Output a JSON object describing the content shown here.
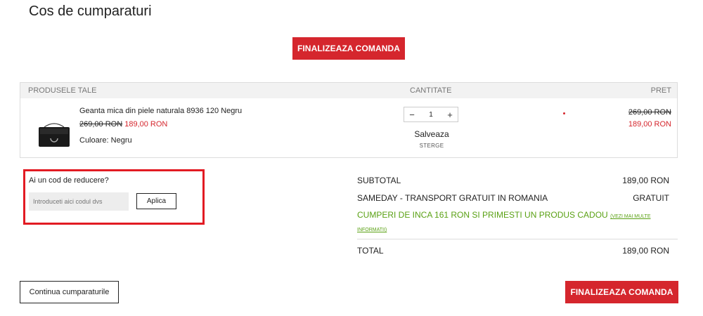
{
  "title": "Cos de cumparaturi",
  "checkout_label": "FINALIZEAZA COMANDA",
  "cart": {
    "headers": {
      "products": "PRODUSELE TALE",
      "quantity": "CANTITATE",
      "price": "PRET"
    },
    "item": {
      "name": "Geanta mica din piele naturala 8936 120 Negru",
      "old_price": "269,00 RON",
      "new_price": "189,00 RON",
      "attribute": "Culoare: Negru",
      "quantity": "1",
      "save_label": "Salveaza",
      "remove_label": "STERGE",
      "thumbnail_icon": "black-handbag-image"
    }
  },
  "coupon": {
    "question": "Ai un cod de reducere?",
    "placeholder": "Introduceti aici codul dvs",
    "apply_label": "Aplica"
  },
  "summary": {
    "subtotal_label": "SUBTOTAL",
    "subtotal_value": "189,00 RON",
    "shipping_label": "SAMEDAY - TRANSPORT GRATUIT IN ROMANIA",
    "shipping_value": "GRATUIT",
    "promo_text": "CUMPERI DE INCA 161 RON SI PRIMESTI UN PRODUS CADOU",
    "promo_link": "(VEZI MAI MULTE INFORMATII)",
    "total_label": "TOTAL",
    "total_value": "189,00 RON"
  },
  "continue_label": "Continua cumparaturile",
  "colors": {
    "accent": "#d5262d",
    "promo": "#5aa114",
    "highlight_border": "#e21b23"
  }
}
